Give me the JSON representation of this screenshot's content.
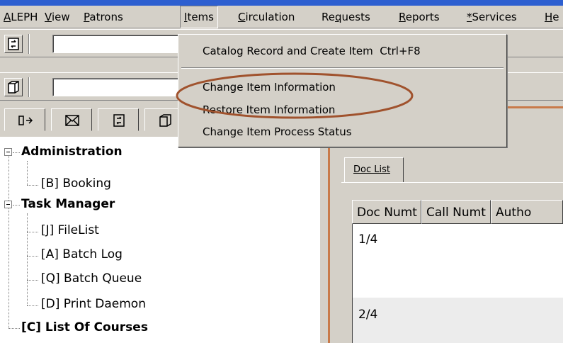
{
  "menubar": {
    "items": [
      {
        "pre": "",
        "key": "A",
        "post": "LEPH"
      },
      {
        "pre": "",
        "key": "V",
        "post": "iew"
      },
      {
        "pre": "",
        "key": "P",
        "post": "atrons"
      },
      {
        "pre": "",
        "key": "I",
        "post": "tems"
      },
      {
        "pre": "",
        "key": "C",
        "post": "irculation"
      },
      {
        "pre": "Re",
        "key": "q",
        "post": "uests"
      },
      {
        "pre": "",
        "key": "R",
        "post": "eports"
      },
      {
        "pre": "",
        "key": "*",
        "post": "Services"
      },
      {
        "pre": "",
        "key": "H",
        "post": "e"
      }
    ],
    "active": "Items"
  },
  "items_menu": {
    "entries": [
      {
        "label": "Catalog Record and Create Item",
        "shortcut": "Ctrl+F8"
      },
      {
        "label": "Change Item Information"
      },
      {
        "label": "Restore Item Information"
      },
      {
        "label": "Change Item Process Status"
      }
    ],
    "highlight_color": "#a0522d"
  },
  "tree": {
    "administration": "Administration",
    "booking": "[B] Booking",
    "task_manager": "Task Manager",
    "filelist": "[J] FileList",
    "batch_log": "[A] Batch Log",
    "batch_queue": "[Q] Batch Queue",
    "print_daemon": "[D] Print Daemon",
    "list_of_courses": "[C] List Of Courses"
  },
  "doc_list": {
    "tab_label": "Doc List",
    "columns": [
      "Doc Numt",
      "Call Numt",
      "Autho"
    ],
    "rows": [
      "1/4",
      "2/4"
    ]
  },
  "colors": {
    "accent_brown": "#c87a4a",
    "window_bg": "#d4d0c8",
    "titlebar": "#2d5fd0"
  }
}
